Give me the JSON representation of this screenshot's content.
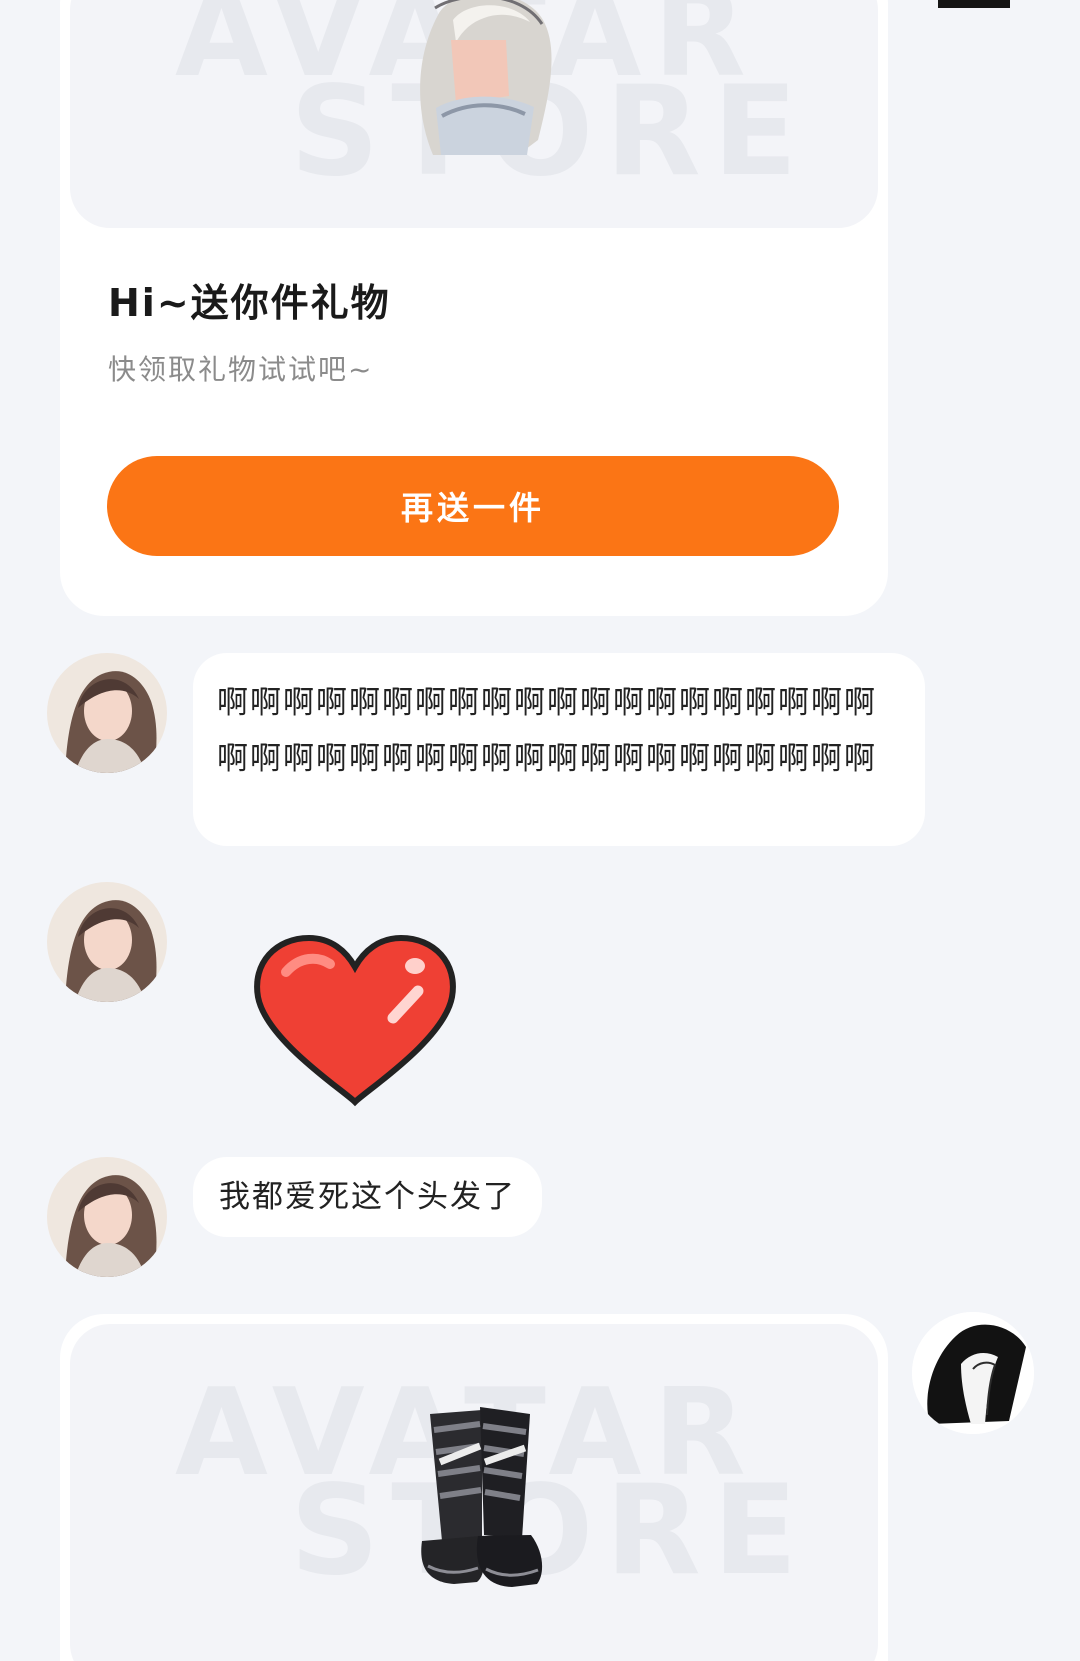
{
  "gift_card": {
    "title": "Hi~送你件礼物",
    "subtitle": "快领取礼物试试吧~",
    "button_label": "再送一件",
    "watermark_line1": "AVATAR",
    "watermark_line2": "STORE"
  },
  "messages": [
    {
      "type": "text",
      "text": "啊啊啊啊啊啊啊啊啊啊啊啊啊啊啊啊啊啊啊啊啊啊啊啊啊啊啊啊啊啊啊啊啊啊啊啊啊啊啊啊"
    },
    {
      "type": "sticker",
      "sticker": "heart-icon"
    },
    {
      "type": "text",
      "text": "我都爱死这个头发了"
    }
  ],
  "gift_card_2": {
    "watermark_line1": "AVATAR",
    "watermark_line2": "STORE"
  },
  "colors": {
    "background": "#f3f5f9",
    "card": "#ffffff",
    "accent": "#fb7515",
    "heart": "#e8382f"
  }
}
